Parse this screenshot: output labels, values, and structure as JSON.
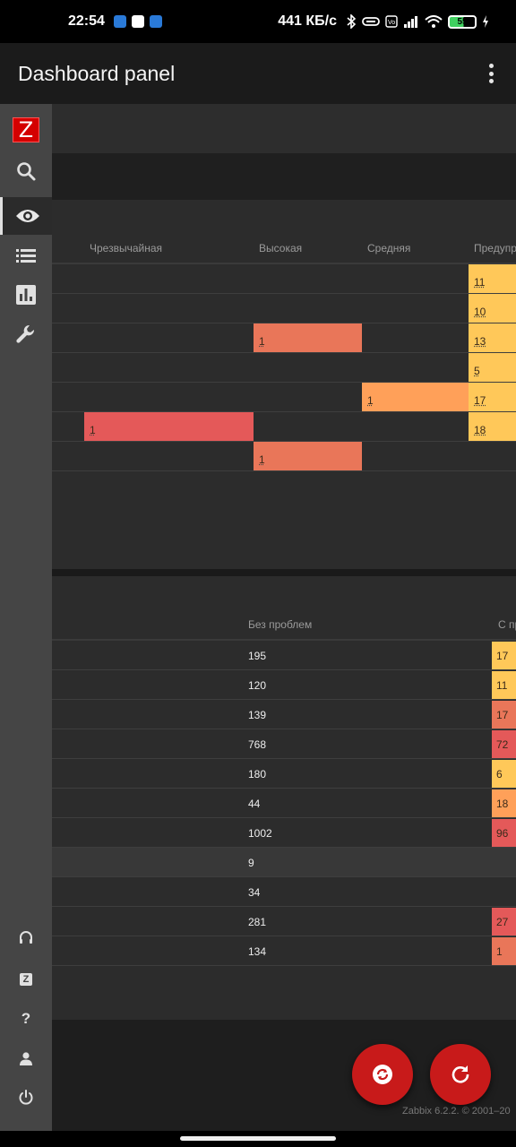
{
  "status_bar": {
    "time": "22:54",
    "net_speed": "441 КБ/с",
    "battery_level": "55",
    "icons": [
      "bluetooth-icon",
      "link-icon",
      "volte-icon",
      "signal-icon",
      "wifi-icon",
      "battery-icon",
      "charging-icon"
    ]
  },
  "app_bar": {
    "title": "Dashboard panel",
    "menu_icon": "more-vertical-icon"
  },
  "sidebar": {
    "items": [
      {
        "name": "zabbix-logo",
        "label": "Z",
        "active": false
      },
      {
        "name": "search-icon",
        "active": false
      },
      {
        "name": "eye-icon",
        "active": true
      },
      {
        "name": "list-icon",
        "active": false
      },
      {
        "name": "bar-chart-icon",
        "active": false
      },
      {
        "name": "wrench-icon",
        "active": false
      }
    ],
    "bottom_items": [
      {
        "name": "headset-icon"
      },
      {
        "name": "zabbix-share-icon",
        "label": "Z"
      },
      {
        "name": "help-icon",
        "label": "?"
      },
      {
        "name": "user-icon"
      },
      {
        "name": "power-icon"
      }
    ]
  },
  "problems_by_severity": {
    "headers": [
      "Чрезвычайная",
      "Высокая",
      "Средняя",
      "Предупр"
    ],
    "rows": [
      {
        "disaster": "",
        "high": "",
        "average": "",
        "warning": "11"
      },
      {
        "disaster": "",
        "high": "",
        "average": "",
        "warning": "10"
      },
      {
        "disaster": "",
        "high": "1",
        "average": "",
        "warning": "13"
      },
      {
        "disaster": "",
        "high": "",
        "average": "",
        "warning": "5"
      },
      {
        "disaster": "",
        "high": "",
        "average": "1",
        "warning": "17"
      },
      {
        "disaster": "1",
        "high": "",
        "average": "",
        "warning": "18"
      },
      {
        "disaster": "",
        "high": "1",
        "average": "",
        "warning": ""
      }
    ]
  },
  "host_availability": {
    "headers": [
      "Без проблем",
      "С пр"
    ],
    "rows": [
      {
        "ok": "195",
        "problems": "17",
        "severity": "warning"
      },
      {
        "ok": "120",
        "problems": "11",
        "severity": "warning"
      },
      {
        "ok": "139",
        "problems": "17",
        "severity": "high"
      },
      {
        "ok": "768",
        "problems": "72",
        "severity": "disaster"
      },
      {
        "ok": "180",
        "problems": "6",
        "severity": "warning"
      },
      {
        "ok": "44",
        "problems": "18",
        "severity": "average"
      },
      {
        "ok": "1002",
        "problems": "96",
        "severity": "disaster"
      },
      {
        "ok": "9",
        "problems": "",
        "severity": ""
      },
      {
        "ok": "34",
        "problems": "",
        "severity": ""
      },
      {
        "ok": "281",
        "problems": "27",
        "severity": "disaster"
      },
      {
        "ok": "134",
        "problems": "1",
        "severity": "high"
      }
    ]
  },
  "fabs": [
    {
      "name": "auto-refresh-button",
      "icon": "sync-icon"
    },
    {
      "name": "refresh-button",
      "icon": "refresh-icon"
    }
  ],
  "footer": "Zabbix 6.2.2. © 2001–20",
  "colors": {
    "disaster": "#e45959",
    "high": "#e97659",
    "average": "#ffa059",
    "warning": "#ffc859",
    "fab": "#c81a1a",
    "logo": "#d40000"
  }
}
